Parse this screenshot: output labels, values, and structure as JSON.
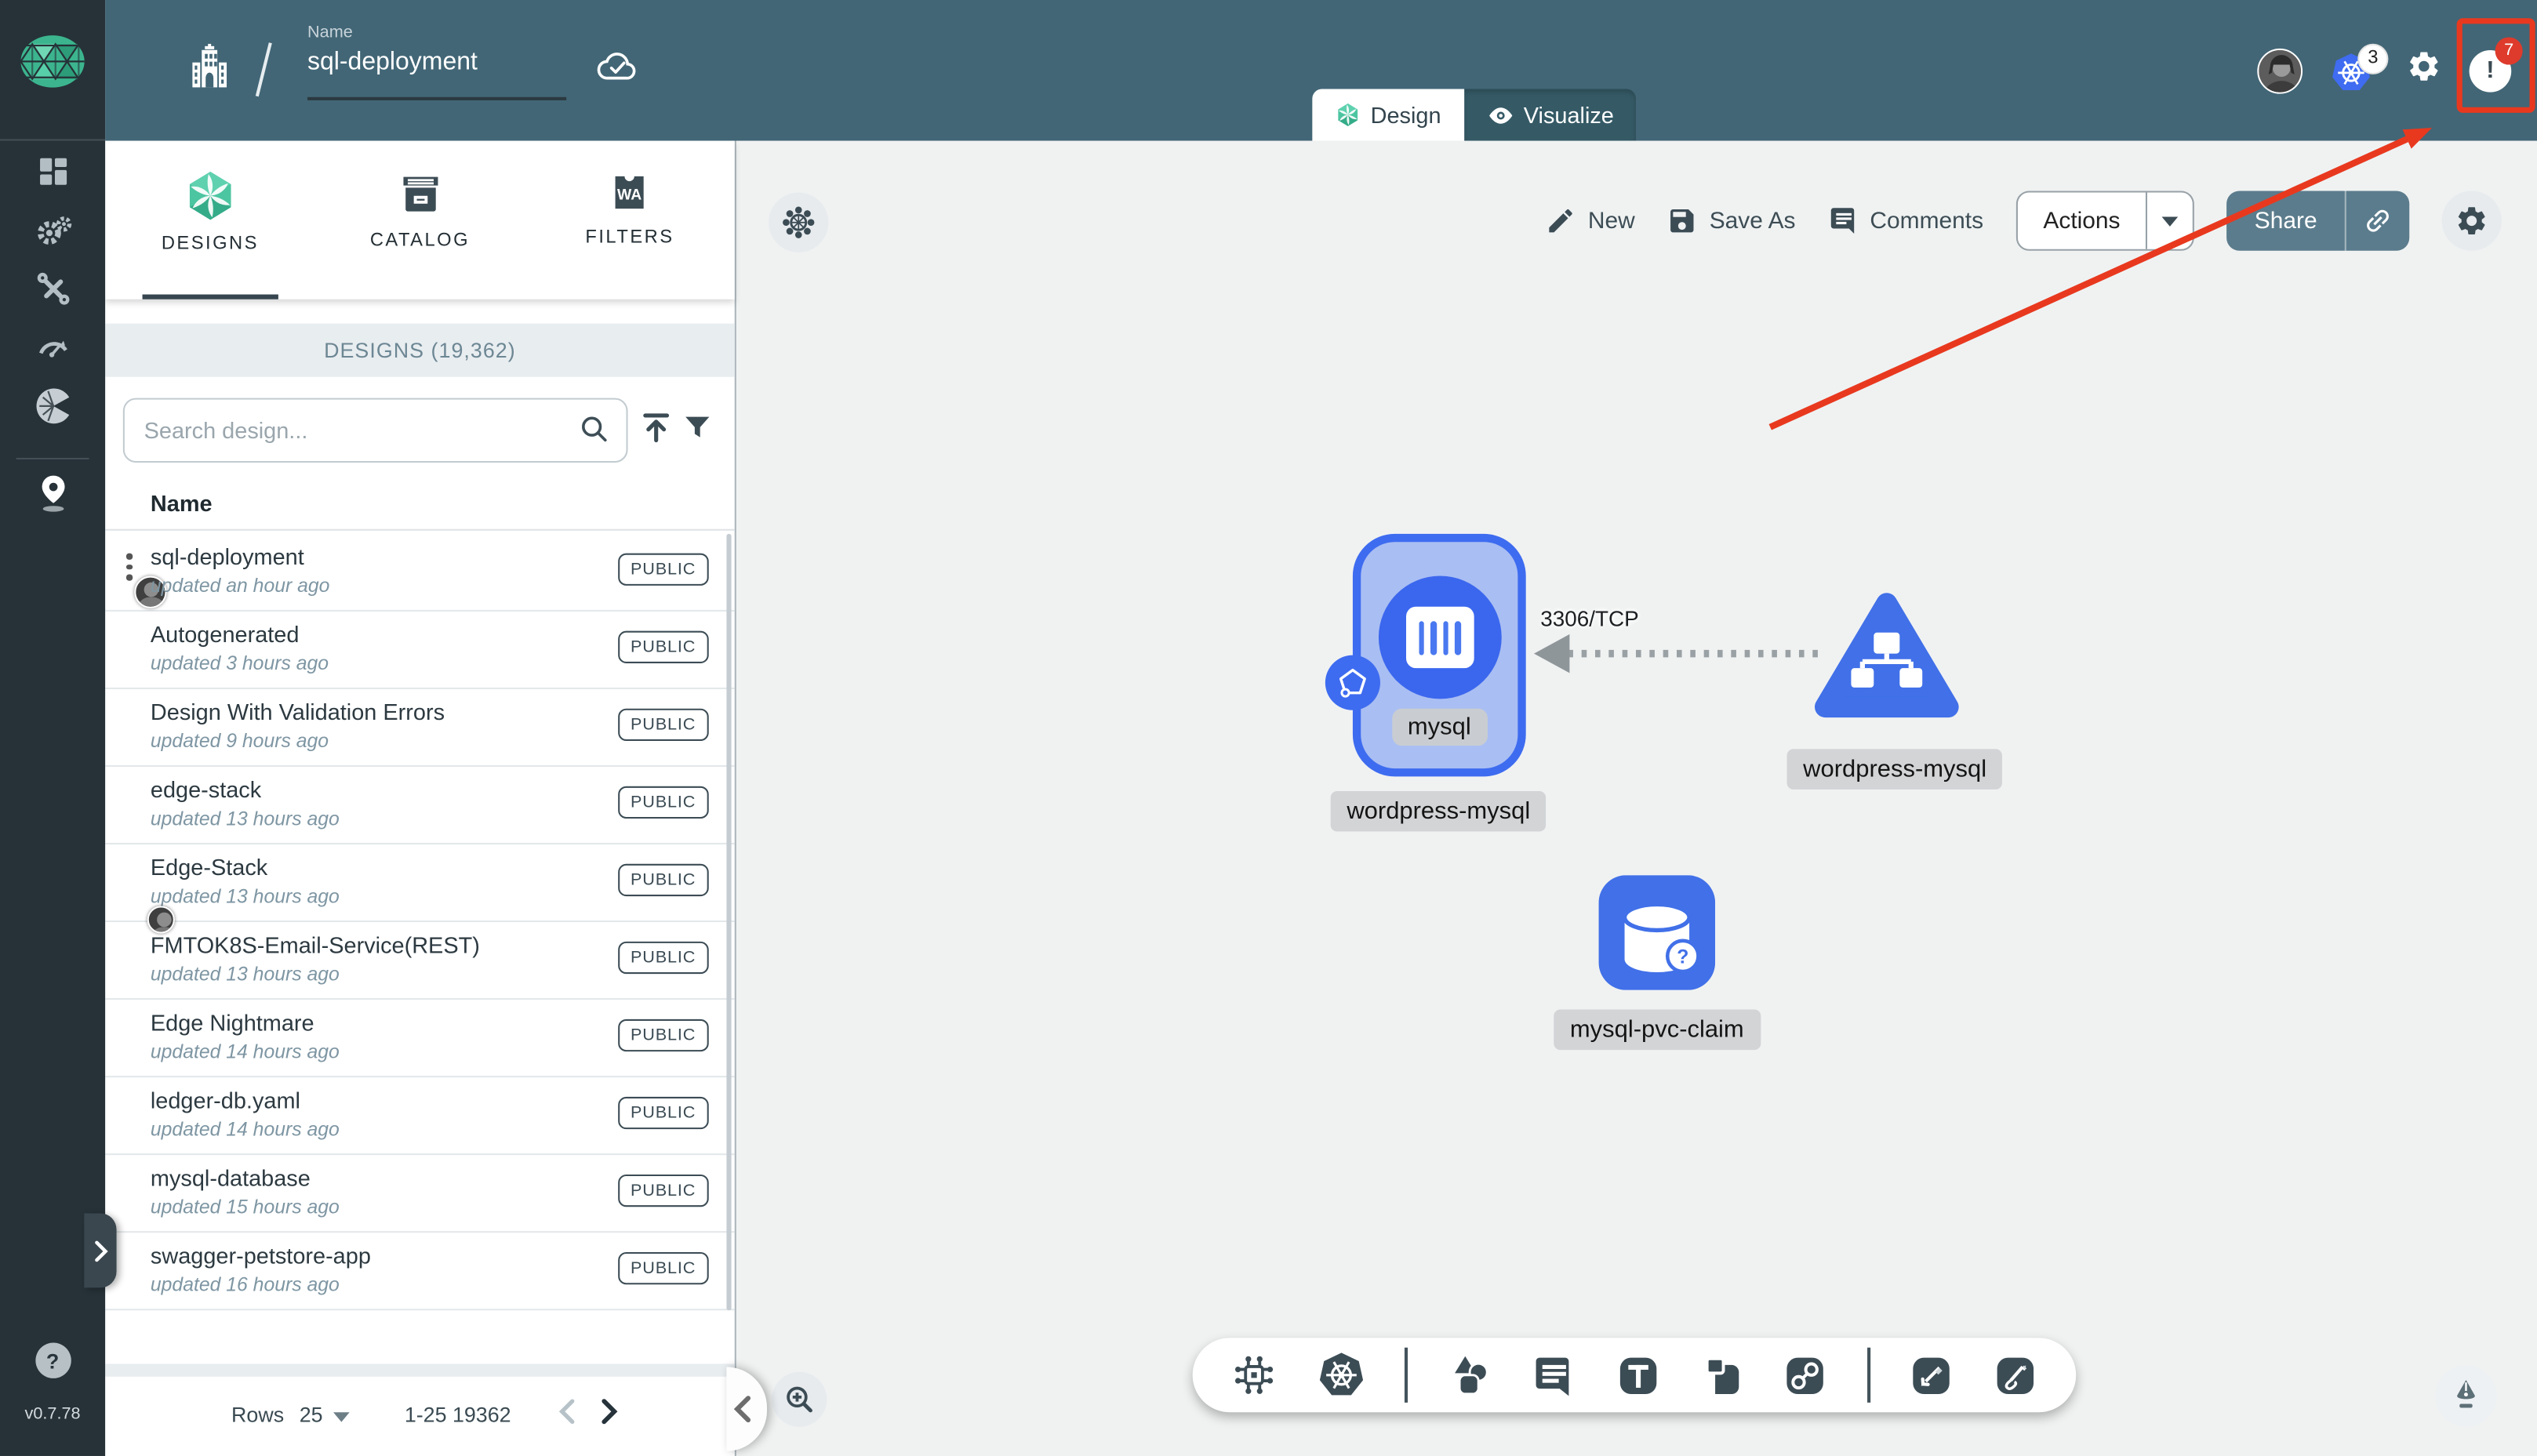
{
  "header": {
    "breadcrumb_separator": "/",
    "name_label": "Name",
    "name_value": "sql-deployment",
    "mode_tabs": {
      "design": "Design",
      "visualize": "Visualize"
    },
    "kubernetes_context_count": "3",
    "notifications_count": "7",
    "notification_glyph": "!"
  },
  "sidebar": {
    "icons": [
      "meshery-logo",
      "dashboard-icon",
      "lifecycle-gears-icon",
      "configuration-wrench-icon",
      "performance-gauge-icon",
      "extensions-icon",
      "kanvas-pin-icon"
    ],
    "help_glyph": "?",
    "version": "v0.7.78"
  },
  "panel": {
    "tabs": [
      {
        "label": "DESIGNS"
      },
      {
        "label": "CATALOG"
      },
      {
        "label": "FILTERS",
        "icon_text": "WA"
      }
    ],
    "subheader": "DESIGNS (19,362)",
    "search_placeholder": "Search design...",
    "column_name": "Name",
    "rows": [
      {
        "name": "sql-deployment",
        "updated": "updated an hour ago",
        "badge": "PUBLIC"
      },
      {
        "name": "Autogenerated",
        "updated": "updated 3 hours ago",
        "badge": "PUBLIC"
      },
      {
        "name": "Design With Validation Errors",
        "updated": "updated 9 hours ago",
        "badge": "PUBLIC"
      },
      {
        "name": "edge-stack",
        "updated": "updated 13 hours ago",
        "badge": "PUBLIC"
      },
      {
        "name": "Edge-Stack",
        "updated": "updated 13 hours ago",
        "badge": "PUBLIC"
      },
      {
        "name": "FMTOK8S-Email-Service(REST)",
        "updated": "updated 13 hours ago",
        "badge": "PUBLIC"
      },
      {
        "name": "Edge Nightmare",
        "updated": "updated 14 hours ago",
        "badge": "PUBLIC"
      },
      {
        "name": "ledger-db.yaml",
        "updated": "updated 14 hours ago",
        "badge": "PUBLIC"
      },
      {
        "name": "mysql-database",
        "updated": "updated 15 hours ago",
        "badge": "PUBLIC"
      },
      {
        "name": "swagger-petstore-app",
        "updated": "updated 16 hours ago",
        "badge": "PUBLIC"
      }
    ],
    "pagination": {
      "rows_label": "Rows",
      "rows_per_page": "25",
      "range": "1-25 19362"
    }
  },
  "canvas": {
    "actions": {
      "new": "New",
      "save_as": "Save As",
      "comments": "Comments",
      "actions": "Actions",
      "share": "Share"
    },
    "edge_label": "3306/TCP",
    "nodes": {
      "mysql": {
        "label": "mysql",
        "group_label": "wordpress-mysql"
      },
      "service": {
        "label": "wordpress-mysql"
      },
      "pvc": {
        "label": "mysql-pvc-claim",
        "badge_glyph": "?"
      }
    }
  },
  "colors": {
    "header": "#426676",
    "sidebar": "#263238",
    "accent_green": "#4cc5a1",
    "node_blue": "#4170e8",
    "node_fill": "#a9bef3",
    "share_button": "#5b7c8c",
    "annotation_red": "#e8391f"
  }
}
